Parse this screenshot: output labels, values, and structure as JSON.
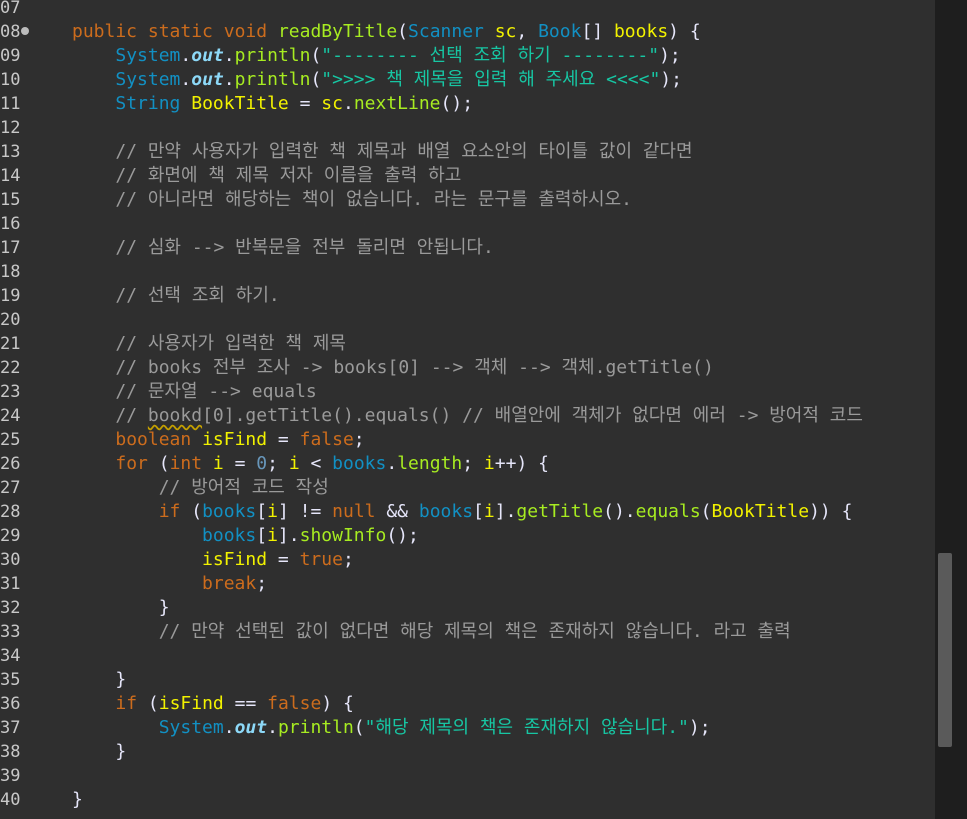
{
  "editor": {
    "lines": [
      {
        "n": "07",
        "indent": "",
        "tokens": []
      },
      {
        "n": "08",
        "fold": true,
        "indent": "",
        "tokens": [
          [
            "kw",
            "public"
          ],
          [
            "op",
            " "
          ],
          [
            "kw",
            "static"
          ],
          [
            "op",
            " "
          ],
          [
            "kw",
            "void"
          ],
          [
            "op",
            " "
          ],
          [
            "mt",
            "readByTitle"
          ],
          [
            "op",
            "("
          ],
          [
            "ty",
            "Scanner"
          ],
          [
            "op",
            " "
          ],
          [
            "id",
            "sc"
          ],
          [
            "op",
            ", "
          ],
          [
            "ty",
            "Book"
          ],
          [
            "op",
            "[] "
          ],
          [
            "id",
            "books"
          ],
          [
            "op",
            ") {"
          ]
        ]
      },
      {
        "n": "09",
        "indent": "    ",
        "tokens": [
          [
            "ty",
            "System"
          ],
          [
            "op",
            "."
          ],
          [
            "out",
            "out"
          ],
          [
            "op",
            "."
          ],
          [
            "mt",
            "println"
          ],
          [
            "op",
            "("
          ],
          [
            "st",
            "\"-------- 선택 조회 하기 --------\""
          ],
          [
            "op",
            ");"
          ]
        ]
      },
      {
        "n": "10",
        "indent": "    ",
        "tokens": [
          [
            "ty",
            "System"
          ],
          [
            "op",
            "."
          ],
          [
            "out",
            "out"
          ],
          [
            "op",
            "."
          ],
          [
            "mt",
            "println"
          ],
          [
            "op",
            "("
          ],
          [
            "st",
            "\">>>> 책 제목을 입력 해 주세요 <<<<\""
          ],
          [
            "op",
            ");"
          ]
        ]
      },
      {
        "n": "11",
        "indent": "    ",
        "tokens": [
          [
            "ty",
            "String"
          ],
          [
            "op",
            " "
          ],
          [
            "id",
            "BookTitle"
          ],
          [
            "op",
            " = "
          ],
          [
            "id",
            "sc"
          ],
          [
            "op",
            "."
          ],
          [
            "mt",
            "nextLine"
          ],
          [
            "op",
            "();"
          ]
        ]
      },
      {
        "n": "12",
        "indent": "",
        "tokens": []
      },
      {
        "n": "13",
        "indent": "    ",
        "tokens": [
          [
            "cm",
            "// 만약 사용자가 입력한 책 제목과 배열 요소안의 타이틀 값이 같다면"
          ]
        ]
      },
      {
        "n": "14",
        "indent": "    ",
        "tokens": [
          [
            "cm",
            "// 화면에 책 제목 저자 이름을 출력 하고"
          ]
        ]
      },
      {
        "n": "15",
        "indent": "    ",
        "tokens": [
          [
            "cm",
            "// 아니라면 해당하는 책이 없습니다. 라는 문구를 출력하시오."
          ]
        ]
      },
      {
        "n": "16",
        "indent": "",
        "tokens": []
      },
      {
        "n": "17",
        "indent": "    ",
        "tokens": [
          [
            "cm",
            "// 심화 --> 반복문을 전부 돌리면 안됩니다."
          ]
        ]
      },
      {
        "n": "18",
        "indent": "",
        "tokens": []
      },
      {
        "n": "19",
        "indent": "    ",
        "tokens": [
          [
            "cm",
            "// 선택 조회 하기."
          ]
        ]
      },
      {
        "n": "20",
        "indent": "",
        "tokens": []
      },
      {
        "n": "21",
        "indent": "    ",
        "tokens": [
          [
            "cm",
            "// 사용자가 입력한 책 제목"
          ]
        ]
      },
      {
        "n": "22",
        "indent": "    ",
        "tokens": [
          [
            "cm",
            "// books 전부 조사 -> books[0] --> 객체 --> 객체.getTitle()"
          ]
        ]
      },
      {
        "n": "23",
        "indent": "    ",
        "tokens": [
          [
            "cm",
            "// 문자열 --> equals"
          ]
        ]
      },
      {
        "n": "24",
        "indent": "    ",
        "tokens": [
          [
            "cm",
            "// "
          ],
          [
            "cm squig",
            "bookd"
          ],
          [
            "cm",
            "[0].getTitle().equals() // 배열안에 객체가 없다면 에러 -> 방어적 코드"
          ]
        ]
      },
      {
        "n": "25",
        "indent": "    ",
        "tokens": [
          [
            "kw",
            "boolean"
          ],
          [
            "op",
            " "
          ],
          [
            "id",
            "isFind"
          ],
          [
            "op",
            " = "
          ],
          [
            "kw",
            "false"
          ],
          [
            "op",
            ";"
          ]
        ]
      },
      {
        "n": "26",
        "indent": "    ",
        "tokens": [
          [
            "kw",
            "for"
          ],
          [
            "op",
            " ("
          ],
          [
            "kw",
            "int"
          ],
          [
            "op",
            " "
          ],
          [
            "id",
            "i"
          ],
          [
            "op",
            " = "
          ],
          [
            "num",
            "0"
          ],
          [
            "op",
            "; "
          ],
          [
            "id",
            "i"
          ],
          [
            "op",
            " < "
          ],
          [
            "obj",
            "books"
          ],
          [
            "op",
            "."
          ],
          [
            "mt",
            "length"
          ],
          [
            "op",
            "; "
          ],
          [
            "id",
            "i"
          ],
          [
            "op",
            "++) {"
          ]
        ]
      },
      {
        "n": "27",
        "indent": "        ",
        "tokens": [
          [
            "cm",
            "// 방어적 코드 작성"
          ]
        ]
      },
      {
        "n": "28",
        "indent": "        ",
        "tokens": [
          [
            "kw",
            "if"
          ],
          [
            "op",
            " ("
          ],
          [
            "obj",
            "books"
          ],
          [
            "op",
            "["
          ],
          [
            "id",
            "i"
          ],
          [
            "op",
            "] != "
          ],
          [
            "kw",
            "null"
          ],
          [
            "op",
            " && "
          ],
          [
            "obj",
            "books"
          ],
          [
            "op",
            "["
          ],
          [
            "id",
            "i"
          ],
          [
            "op",
            "]."
          ],
          [
            "mt",
            "getTitle"
          ],
          [
            "op",
            "()."
          ],
          [
            "mt",
            "equals"
          ],
          [
            "op",
            "("
          ],
          [
            "id",
            "BookTitle"
          ],
          [
            "op",
            ")) {"
          ]
        ]
      },
      {
        "n": "29",
        "indent": "            ",
        "tokens": [
          [
            "obj",
            "books"
          ],
          [
            "op",
            "["
          ],
          [
            "id",
            "i"
          ],
          [
            "op",
            "]."
          ],
          [
            "mt",
            "showInfo"
          ],
          [
            "op",
            "();"
          ]
        ]
      },
      {
        "n": "30",
        "indent": "            ",
        "tokens": [
          [
            "id",
            "isFind"
          ],
          [
            "op",
            " = "
          ],
          [
            "kw",
            "true"
          ],
          [
            "op",
            ";"
          ]
        ]
      },
      {
        "n": "31",
        "indent": "            ",
        "tokens": [
          [
            "kw",
            "break"
          ],
          [
            "op",
            ";"
          ]
        ]
      },
      {
        "n": "32",
        "indent": "        ",
        "tokens": [
          [
            "op",
            "}"
          ]
        ]
      },
      {
        "n": "33",
        "indent": "        ",
        "tokens": [
          [
            "cm",
            "// 만약 선택된 값이 없다면 해당 제목의 책은 존재하지 않습니다. 라고 출력"
          ]
        ]
      },
      {
        "n": "34",
        "indent": "",
        "tokens": []
      },
      {
        "n": "35",
        "indent": "    ",
        "tokens": [
          [
            "op",
            "}"
          ]
        ]
      },
      {
        "n": "36",
        "indent": "    ",
        "tokens": [
          [
            "kw",
            "if"
          ],
          [
            "op",
            " ("
          ],
          [
            "id",
            "isFind"
          ],
          [
            "op",
            " == "
          ],
          [
            "kw",
            "false"
          ],
          [
            "op",
            ") {"
          ]
        ]
      },
      {
        "n": "37",
        "indent": "        ",
        "tokens": [
          [
            "ty",
            "System"
          ],
          [
            "op",
            "."
          ],
          [
            "out",
            "out"
          ],
          [
            "op",
            "."
          ],
          [
            "mt",
            "println"
          ],
          [
            "op",
            "("
          ],
          [
            "st",
            "\"해당 제목의 책은 존재하지 않습니다.\""
          ],
          [
            "op",
            ");"
          ]
        ]
      },
      {
        "n": "38",
        "indent": "    ",
        "tokens": [
          [
            "op",
            "}"
          ]
        ]
      },
      {
        "n": "39",
        "indent": "",
        "tokens": []
      },
      {
        "n": "40",
        "indent": "",
        "tokens": [
          [
            "op",
            "}"
          ]
        ]
      }
    ]
  },
  "scrollbar": {
    "position_fraction": 0.68
  }
}
